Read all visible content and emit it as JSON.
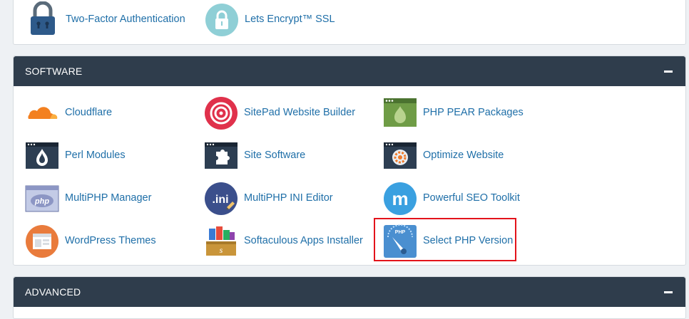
{
  "security": {
    "items": [
      {
        "label": "Two-Factor Authentication",
        "icon": "padlock-icon"
      },
      {
        "label": "Lets Encrypt™ SSL",
        "icon": "ssl-lock-icon"
      }
    ]
  },
  "software": {
    "title": "SOFTWARE",
    "items": [
      {
        "label": "Cloudflare",
        "icon": "cloudflare-icon"
      },
      {
        "label": "SitePad Website Builder",
        "icon": "sitepad-icon"
      },
      {
        "label": "PHP PEAR Packages",
        "icon": "php-pear-icon"
      },
      {
        "label": "Perl Modules",
        "icon": "perl-icon"
      },
      {
        "label": "Site Software",
        "icon": "site-software-icon"
      },
      {
        "label": "Optimize Website",
        "icon": "optimize-icon"
      },
      {
        "label": "MultiPHP Manager",
        "icon": "multiphp-manager-icon"
      },
      {
        "label": "MultiPHP INI Editor",
        "icon": "ini-editor-icon"
      },
      {
        "label": "Powerful SEO Toolkit",
        "icon": "seo-toolkit-icon"
      },
      {
        "label": "WordPress Themes",
        "icon": "wordpress-themes-icon"
      },
      {
        "label": "Softaculous Apps Installer",
        "icon": "softaculous-icon"
      },
      {
        "label": "Select PHP Version",
        "icon": "php-gauge-icon"
      }
    ]
  },
  "advanced": {
    "title": "ADVANCED"
  },
  "colors": {
    "header": "#2f3d4c",
    "link": "#1f6fa8",
    "highlight": "#e3131b"
  }
}
